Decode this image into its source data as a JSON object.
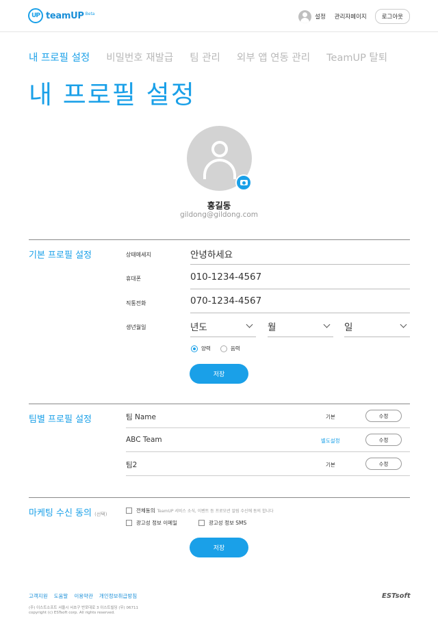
{
  "header": {
    "logo_mark": "UP",
    "logo_text": "teamUP",
    "logo_badge": "Beta",
    "settings_label": "설정",
    "admin_label": "관리자페이지",
    "logout_label": "로그아웃"
  },
  "tabs": [
    {
      "label": "내 프로필 설정",
      "active": true
    },
    {
      "label": "비밀번호 재발급"
    },
    {
      "label": "팀 관리"
    },
    {
      "label": "외부 앱 연동 관리"
    },
    {
      "label": "TeamUP 탈퇴"
    }
  ],
  "page_title": "내 프로필 설정",
  "profile": {
    "name": "홍길동",
    "email": "gildong@gildong.com"
  },
  "basic": {
    "title": "기본 프로필 설정",
    "status_label": "상태메세지",
    "status_value": "안녕하세요",
    "mobile_label": "휴대폰",
    "mobile_value": "010-1234-4567",
    "phone_label": "직통전화",
    "phone_value": "070-1234-4567",
    "birth_label": "생년월일",
    "year_value": "년도",
    "month_value": "월",
    "day_value": "일",
    "solar_label": "양력",
    "lunar_label": "음력",
    "calendar_selected": "양력",
    "save_label": "저장"
  },
  "team": {
    "title": "팀별 프로필 설정",
    "rows": [
      {
        "name": "팀 Name",
        "status": "기본",
        "edit": "수정"
      },
      {
        "name": "ABC Team",
        "status": "별도설정",
        "edit": "수정"
      },
      {
        "name": "팀2",
        "status": "기본",
        "edit": "수정"
      }
    ]
  },
  "marketing": {
    "title": "마케팅 수신 동의",
    "title_note": "(선택)",
    "all_label": "전체동의",
    "all_desc": "TeamUP 서비스 소식, 이벤트 등 프로모션 알림 수신에 동의 합니다",
    "email_label": "광고성 정보 이메일",
    "sms_label": "광고성 정보 SMS",
    "save_label": "저장"
  },
  "footer": {
    "links": [
      "고객지원",
      "도움말",
      "이용약관",
      "개인정보취급방침"
    ],
    "address": "(주) 이스트소프트 서울시 서초구 반포대로 3 이스트빌딩 (우) 06711",
    "copyright": "copyright (c) ESTsoft corp. All rights reserved.",
    "company_logo": "ESTsoft"
  },
  "colors": {
    "accent": "#1aa0e8"
  }
}
